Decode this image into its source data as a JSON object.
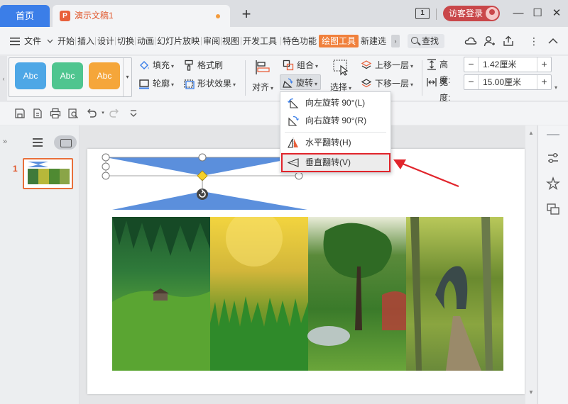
{
  "titlebar": {
    "home_tab": "首页",
    "doc_tab": "演示文稿1",
    "doc_logo": "P",
    "plus": "+",
    "badge": "1",
    "login": "访客登录",
    "minimize": "—",
    "maximize": "☐",
    "close": "✕"
  },
  "menubar": {
    "file": "文件",
    "items": [
      "开始",
      "插入",
      "设计",
      "切换",
      "动画",
      "幻灯片放映",
      "审阅",
      "视图",
      "开发工具",
      "特色功能",
      "绘图工具",
      "新建选"
    ],
    "active_index": 10,
    "search": "查找",
    "more": "⋮"
  },
  "ribbon": {
    "style_swatches": [
      {
        "label": "Abc",
        "color": "#4ea7e6"
      },
      {
        "label": "Abc",
        "color": "#4fc58f"
      },
      {
        "label": "Abc",
        "color": "#f5a63a"
      }
    ],
    "fill": "填充",
    "outline": "轮廓",
    "format_painter": "格式刷",
    "shape_effects": "形状效果",
    "align": "对齐",
    "group": "组合",
    "rotate": "旋转",
    "select": "选择",
    "bring_forward": "上移一层",
    "send_backward": "下移一层",
    "height_label": "高度:",
    "height_value": "1.42厘米",
    "width_label": "宽度:",
    "width_value": "15.00厘米",
    "minus": "−",
    "plus": "+"
  },
  "dropdown": {
    "items": [
      {
        "label": "向左旋转 90°(L)"
      },
      {
        "label": "向右旋转 90°(R)"
      },
      {
        "label": "水平翻转(H)"
      },
      {
        "label": "垂直翻转(V)"
      }
    ],
    "highlighted_index": 3
  },
  "slides": {
    "current": "1"
  },
  "colors": {
    "accent": "#3b7ee8",
    "drawing_tools": "#f0803c",
    "highlight": "#e1242b",
    "shape_fill": "#5b8fdc"
  }
}
